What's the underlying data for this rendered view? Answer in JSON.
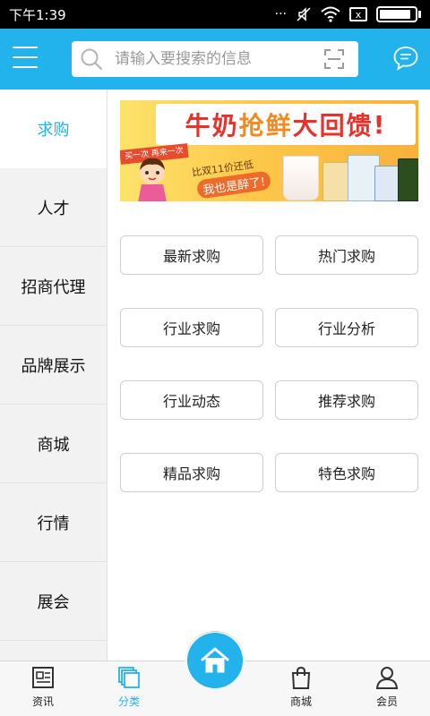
{
  "status_bar": {
    "time": "下午1:39",
    "sim_label": "x"
  },
  "header": {
    "search_placeholder": "请输入要搜索的信息",
    "accent_color": "#22b3ec"
  },
  "sidebar": {
    "items": [
      {
        "label": "求购",
        "active": true
      },
      {
        "label": "人才",
        "active": false
      },
      {
        "label": "招商代理",
        "active": false
      },
      {
        "label": "品牌展示",
        "active": false
      },
      {
        "label": "商城",
        "active": false
      },
      {
        "label": "行情",
        "active": false
      },
      {
        "label": "展会",
        "active": false
      }
    ]
  },
  "banner": {
    "title_part1": "牛奶",
    "title_part2": "抢鲜",
    "title_part3": "大回馈",
    "title_mark": "!",
    "subtitle": "比双11价还低",
    "tag": "我也是醉了!",
    "ribbon": "买一次 再来一次"
  },
  "categories": {
    "buttons": [
      "最新求购",
      "热门求购",
      "行业求购",
      "行业分析",
      "行业动态",
      "推荐求购",
      "精品求购",
      "特色求购"
    ]
  },
  "bottom_nav": {
    "items": [
      {
        "label": "资讯",
        "icon": "news-icon",
        "active": false
      },
      {
        "label": "分类",
        "icon": "category-icon",
        "active": true
      },
      {
        "label": "",
        "icon": "home-icon",
        "active": false
      },
      {
        "label": "商城",
        "icon": "shop-bag-icon",
        "active": false
      },
      {
        "label": "会员",
        "icon": "user-icon",
        "active": false
      }
    ]
  }
}
